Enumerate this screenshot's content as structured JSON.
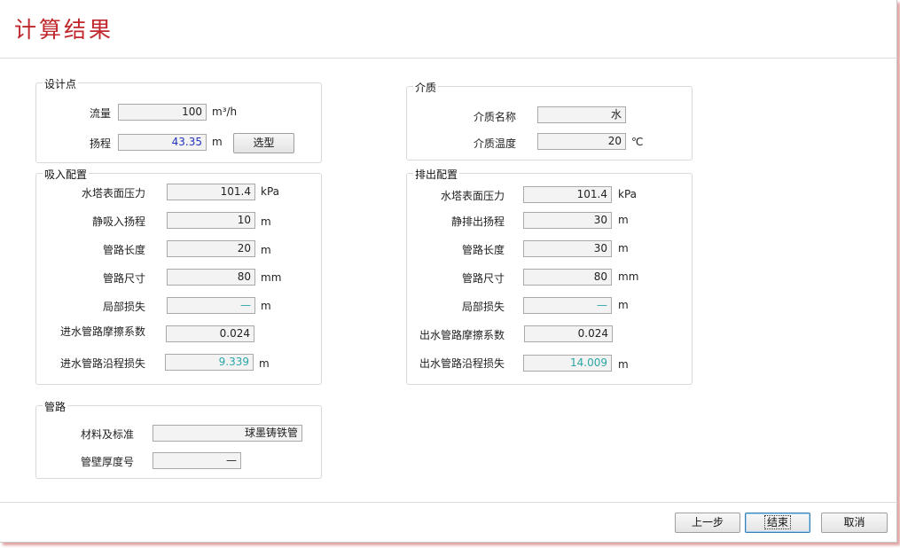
{
  "title": "计算结果",
  "design_point": {
    "group_title": "设计点",
    "flow": {
      "label": "流量",
      "value": "100",
      "unit": "m³/h"
    },
    "head": {
      "label": "扬程",
      "value": "43.35",
      "unit": "m"
    },
    "select_button": "选型"
  },
  "medium": {
    "group_title": "介质",
    "name": {
      "label": "介质名称",
      "value": "水"
    },
    "temperature": {
      "label": "介质温度",
      "value": "20",
      "unit": "℃"
    }
  },
  "suction": {
    "group_title": "吸入配置",
    "tower_pressure": {
      "label": "水塔表面压力",
      "value": "101.4",
      "unit": "kPa"
    },
    "static_head": {
      "label": "静吸入扬程",
      "value": "10",
      "unit": "m"
    },
    "pipe_length": {
      "label": "管路长度",
      "value": "20",
      "unit": "m"
    },
    "pipe_size": {
      "label": "管路尺寸",
      "value": "80",
      "unit": "mm"
    },
    "local_loss": {
      "label": "局部损失",
      "value": "—",
      "unit": "m"
    },
    "friction_coef": {
      "label": "进水管路摩擦系数",
      "value": "0.024"
    },
    "friction_loss": {
      "label": "进水管路沿程损失",
      "value": "9.339",
      "unit": "m"
    }
  },
  "discharge": {
    "group_title": "排出配置",
    "tower_pressure": {
      "label": "水塔表面压力",
      "value": "101.4",
      "unit": "kPa"
    },
    "static_head": {
      "label": "静排出扬程",
      "value": "30",
      "unit": "m"
    },
    "pipe_length": {
      "label": "管路长度",
      "value": "30",
      "unit": "m"
    },
    "pipe_size": {
      "label": "管路尺寸",
      "value": "80",
      "unit": "mm"
    },
    "local_loss": {
      "label": "局部损失",
      "value": "—",
      "unit": "m"
    },
    "friction_coef": {
      "label": "出水管路摩擦系数",
      "value": "0.024"
    },
    "friction_loss": {
      "label": "出水管路沿程损失",
      "value": "14.009",
      "unit": "m"
    }
  },
  "pipe": {
    "group_title": "管路",
    "material": {
      "label": "材料及标准",
      "value": "球墨铸铁管"
    },
    "wall_thickness": {
      "label": "管壁厚度号",
      "value": "—"
    }
  },
  "buttons": {
    "prev": "上一步",
    "finish": "结束",
    "cancel": "取消"
  },
  "colors": {
    "title": "#c0282d",
    "computed_blue": "#2233bb",
    "computed_teal": "#2aa6a6"
  }
}
